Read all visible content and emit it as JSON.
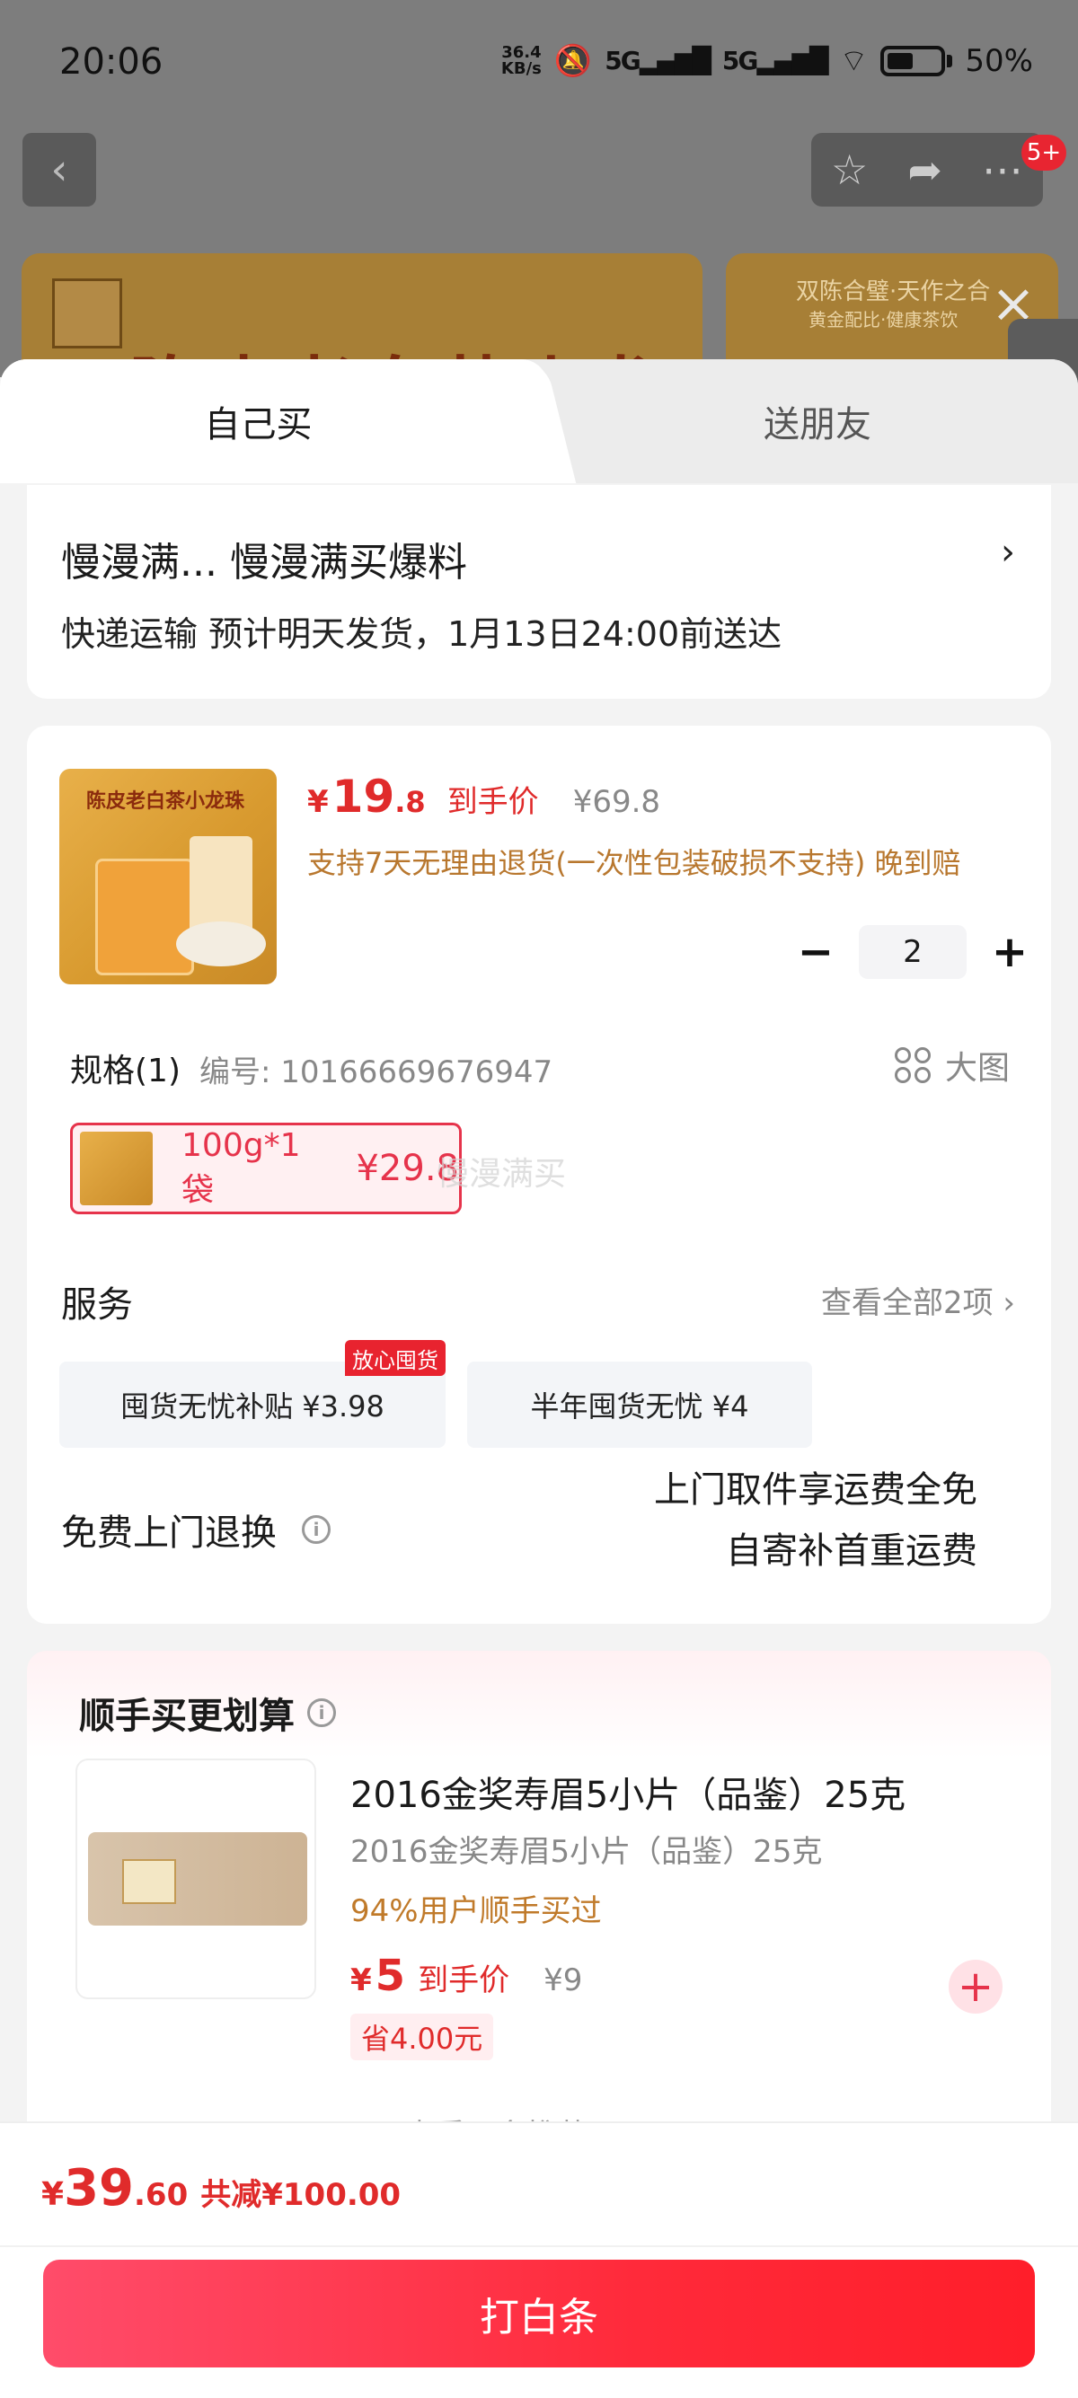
{
  "status_bar": {
    "time": "20:06",
    "net_speed_top": "36.4",
    "net_speed_bottom": "KB/s",
    "signal1": "5G",
    "signal2": "5G",
    "battery": "50%"
  },
  "background": {
    "banner_title": "陈皮老白茶小龙珠",
    "banner_right_line1": "双陈合璧·天作之合",
    "banner_right_line2": "黄金配比·健康茶饮",
    "more_badge": "5+"
  },
  "tabs": {
    "self_label": "自己买",
    "friend_label": "送朋友"
  },
  "address": {
    "title": "慢漫满...  慢漫满买爆料",
    "shipping": "快递运输 预计明天发货，1月13日24:00前送达"
  },
  "product": {
    "image_title": "陈皮老白茶小龙珠",
    "price_yen": "¥",
    "price_int": "19",
    "price_dec": ".8",
    "price_tag": "到手价",
    "original_price": "¥69.8",
    "return_note": "支持7天无理由退货(一次性包装破损不支持) 晚到赔",
    "quantity": "2",
    "spec_label": "规格(1)",
    "spec_code": "编号: 10166669676947",
    "big_image_label": "大图",
    "sku_name": "100g*1袋",
    "sku_price": "¥29.8",
    "watermark": "慢漫满买"
  },
  "services": {
    "label": "服务",
    "view_all": "查看全部2项",
    "items": [
      {
        "label": "囤货无忧补贴  ¥3.98",
        "badge": "放心囤货"
      },
      {
        "label": "半年囤货无忧  ¥4"
      }
    ],
    "free_return_label": "免费上门退换",
    "free_return_line1": "上门取件享运费全免",
    "free_return_line2": "自寄补首重运费"
  },
  "upsell": {
    "title": "顺手买更划算",
    "name": "2016金奖寿眉5小片（品鉴）25克",
    "subtitle": "2016金奖寿眉5小片（品鉴）25克",
    "percent_note": "94%用户顺手买过",
    "price_yen": "¥",
    "price_int": "5",
    "price_tag": "到手价",
    "original_price": "¥9",
    "saving": "省4.00元",
    "more": "查看更多推荐"
  },
  "footer": {
    "total_yen": "¥",
    "total_int": "39",
    "total_dec": ".60",
    "total_cut": "共减¥100.00",
    "pay_button": "打白条"
  },
  "colors": {
    "accent_red": "#e02b2b",
    "sku_border": "#e6334b",
    "pay_button_gradient": "#ff4c6a",
    "note_orange": "#b8772e"
  }
}
